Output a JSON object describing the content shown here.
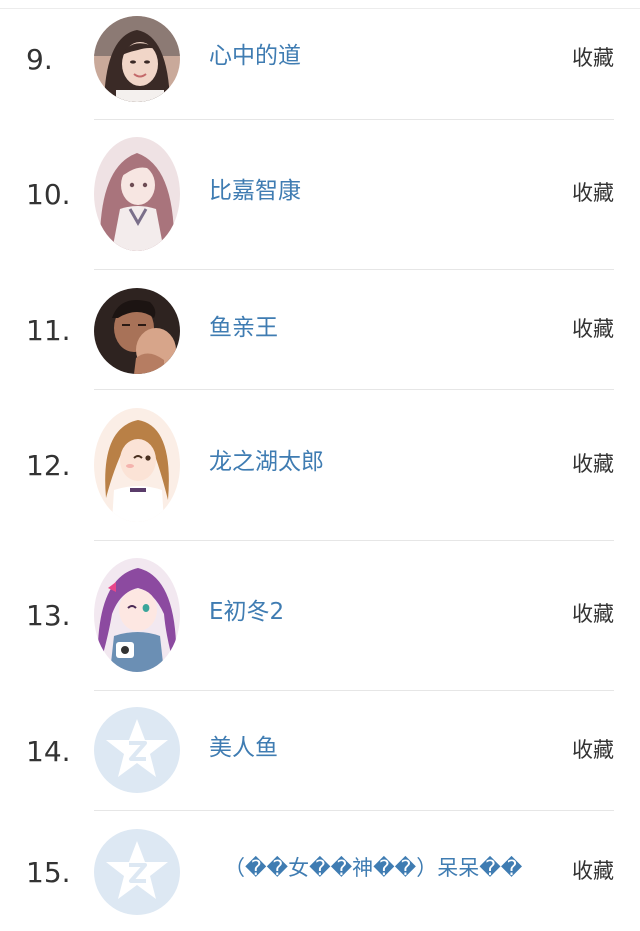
{
  "list": {
    "items": [
      {
        "rank": "9.",
        "name": "心中的道",
        "action": "收藏",
        "avatar": "avatar-photo-woman-icon"
      },
      {
        "rank": "10.",
        "name": "比嘉智康",
        "action": "收藏",
        "avatar": "avatar-anime-girl-icon"
      },
      {
        "rank": "11.",
        "name": "鱼亲王",
        "action": "收藏",
        "avatar": "avatar-photo-man-icon"
      },
      {
        "rank": "12.",
        "name": "龙之湖太郎",
        "action": "收藏",
        "avatar": "avatar-anime-girl-icon"
      },
      {
        "rank": "13.",
        "name": "E初冬2",
        "action": "收藏",
        "avatar": "avatar-anime-girl-icon"
      },
      {
        "rank": "14.",
        "name": "美人鱼",
        "action": "收藏",
        "avatar": "default-qzone-avatar-icon"
      },
      {
        "rank": "15.",
        "name": "（��女��神��）呆呆��",
        "action": "收藏",
        "avatar": "default-qzone-avatar-icon"
      }
    ]
  },
  "colors": {
    "name_link": "#3f7cb2",
    "text": "#333333",
    "divider": "#e6e6e6",
    "default_avatar_bg": "#dde8f3"
  }
}
